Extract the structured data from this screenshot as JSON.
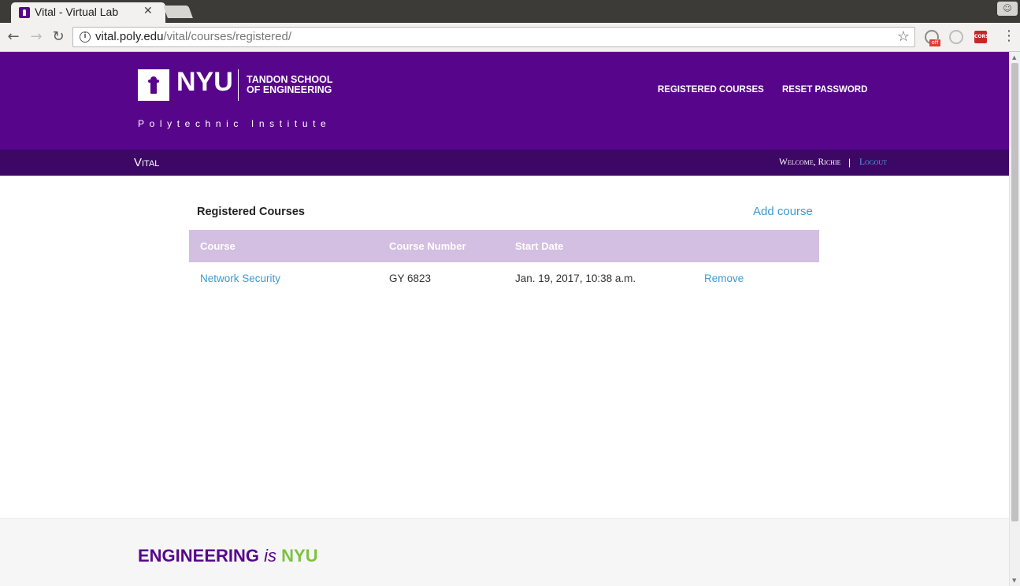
{
  "browser": {
    "tab_title": "Vital - Virtual Lab",
    "tab_close": "✕",
    "url_host": "vital.poly.edu",
    "url_path": "/vital/courses/registered/",
    "ext_badge": "off",
    "ext_cors": "CORS",
    "icons": [
      "back-icon",
      "forward-icon",
      "reload-icon",
      "info-icon",
      "star-icon",
      "menu-icon"
    ]
  },
  "header": {
    "logo_word": "NYU",
    "school_line1": "TANDON SCHOOL",
    "school_line2": "OF ENGINEERING",
    "subtitle": "Polytechnic Institute",
    "nav": {
      "registered": "REGISTERED COURSES",
      "reset": "RESET PASSWORD"
    }
  },
  "subheader": {
    "brand": "Vital",
    "welcome": "Welcome, Richie",
    "separator": "|",
    "logout": "Logout"
  },
  "main": {
    "title": "Registered Courses",
    "add_course": "Add course",
    "columns": [
      "Course",
      "Course Number",
      "Start Date"
    ],
    "rows": [
      {
        "course": "Network Security",
        "number": "GY 6823",
        "start": "Jan. 19, 2017, 10:38 a.m.",
        "action": "Remove"
      }
    ]
  },
  "footer": {
    "eng": "ENGINEERING",
    "is": "is",
    "nyu": "NYU"
  },
  "colors": {
    "brand_purple": "#57068c",
    "dark_purple": "#3d0765",
    "table_header": "#d3bfe1",
    "link_blue": "#3a9bd5",
    "footer_green": "#7cc242"
  }
}
